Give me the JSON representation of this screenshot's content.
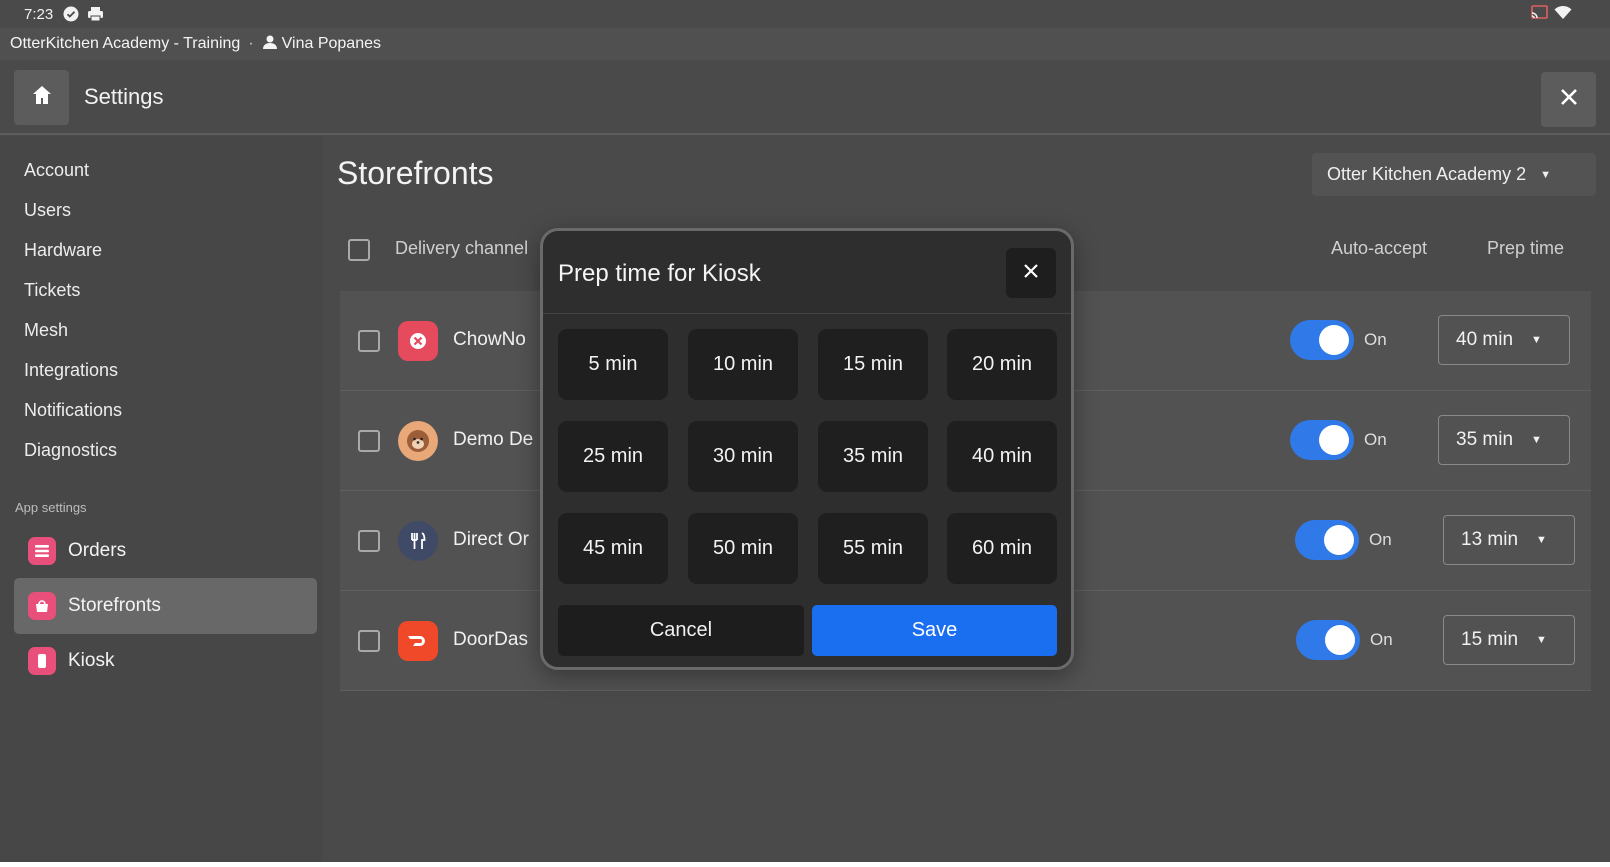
{
  "status_bar": {
    "time": "7:23",
    "left_icons": [
      "check-circle-icon",
      "printer-icon"
    ],
    "right_icons": [
      "cast-icon",
      "wifi-icon"
    ]
  },
  "training_bar": {
    "account": "OtterKitchen Academy - Training",
    "separator": "·",
    "user": "Vina Popanes"
  },
  "header": {
    "title": "Settings",
    "home_icon": "home-icon",
    "close_icon": "close-icon"
  },
  "sidebar": {
    "items": [
      {
        "label": "Account"
      },
      {
        "label": "Users"
      },
      {
        "label": "Hardware"
      },
      {
        "label": "Tickets"
      },
      {
        "label": "Mesh"
      },
      {
        "label": "Integrations"
      },
      {
        "label": "Notifications"
      },
      {
        "label": "Diagnostics"
      }
    ],
    "app_settings_label": "App settings",
    "apps": [
      {
        "label": "Orders",
        "icon": "orders-icon",
        "active": false
      },
      {
        "label": "Storefronts",
        "icon": "storefront-icon",
        "active": true
      },
      {
        "label": "Kiosk",
        "icon": "kiosk-icon",
        "active": false
      }
    ]
  },
  "main": {
    "title": "Storefronts",
    "location": "Otter Kitchen Academy 2",
    "columns": {
      "channel": "Delivery channel",
      "auto_accept": "Auto-accept",
      "prep_time": "Prep time"
    },
    "rows": [
      {
        "name": "ChowNo",
        "logo": "chownow-icon",
        "logo_color": "#e64b5d",
        "auto_accept": "On",
        "prep_time": "40 min"
      },
      {
        "name": "Demo De",
        "logo": "otter-avatar-icon",
        "logo_color": "#e8a878",
        "auto_accept": "On",
        "prep_time": "35 min"
      },
      {
        "name": "Direct Or",
        "logo": "fork-knife-icon",
        "logo_color": "#3f4a66",
        "auto_accept": "On",
        "prep_time": "13 min"
      },
      {
        "name": "DoorDas",
        "logo": "doordash-icon",
        "logo_color": "#f0492a",
        "auto_accept": "On",
        "prep_time": "15 min"
      }
    ]
  },
  "modal": {
    "title": "Prep time for Kiosk",
    "options": [
      "5 min",
      "10 min",
      "15 min",
      "20 min",
      "25 min",
      "30 min",
      "35 min",
      "40 min",
      "45 min",
      "50 min",
      "55 min",
      "60 min"
    ],
    "cancel_label": "Cancel",
    "save_label": "Save"
  },
  "colors": {
    "accent": "#1a6ef0",
    "toggle_on": "#2f7ae8",
    "background": "#4a4a4a",
    "modal_bg": "#2e2e2e"
  }
}
